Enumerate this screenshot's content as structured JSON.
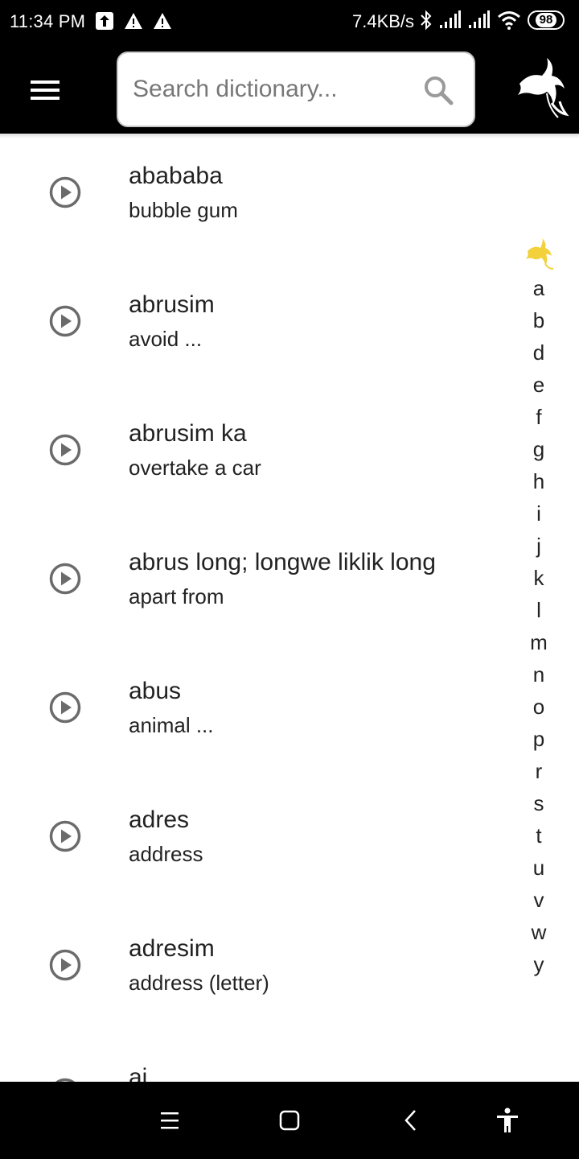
{
  "status_bar": {
    "time": "11:34 PM",
    "left_icons": [
      "upload-arrow-icon",
      "warning-icon",
      "warning-icon"
    ],
    "network_speed": "7.4KB/s",
    "right_icons": [
      "bluetooth-icon",
      "signal-icon",
      "signal-icon",
      "wifi-icon"
    ],
    "battery": "98"
  },
  "app_bar": {
    "menu_icon": "hamburger-menu-icon",
    "search": {
      "placeholder": "Search dictionary...",
      "value": ""
    },
    "search_icon": "search-icon",
    "logo_icon": "bird-of-paradise-logo-icon"
  },
  "entries": [
    {
      "word": "abababa",
      "definition": "bubble gum"
    },
    {
      "word": "abrusim",
      "definition": "avoid ..."
    },
    {
      "word": "abrusim ka",
      "definition": "overtake a car"
    },
    {
      "word": "abrus long; longwe liklik long",
      "definition": "apart from"
    },
    {
      "word": "abus",
      "definition": "animal ..."
    },
    {
      "word": "adres",
      "definition": "address"
    },
    {
      "word": "adresim",
      "definition": "address (letter)"
    },
    {
      "word": "ai",
      "definition": ""
    }
  ],
  "alphabet_index": {
    "top_icon": "bird-of-paradise-icon",
    "accent_color": "#F2D13A",
    "letters": [
      "a",
      "b",
      "d",
      "e",
      "f",
      "g",
      "h",
      "i",
      "j",
      "k",
      "l",
      "m",
      "n",
      "o",
      "p",
      "r",
      "s",
      "t",
      "u",
      "v",
      "w",
      "y"
    ]
  },
  "nav_bar": {
    "buttons": [
      "recents-icon",
      "home-icon",
      "back-icon",
      "accessibility-icon"
    ]
  },
  "colors": {
    "bar_background": "#000000",
    "icon_gray": "#6b6b6b",
    "text": "#222222"
  }
}
